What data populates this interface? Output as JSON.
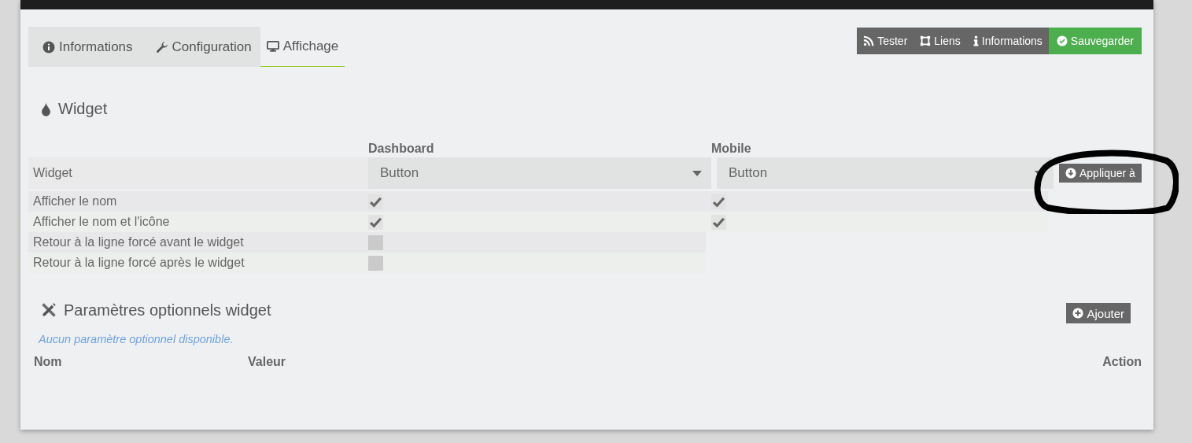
{
  "tabs": [
    {
      "label": "Informations",
      "selected": false
    },
    {
      "label": "Configuration",
      "selected": false
    },
    {
      "label": "Affichage",
      "selected": true
    }
  ],
  "actions": [
    {
      "label": "Tester",
      "kind": "default"
    },
    {
      "label": "Liens",
      "kind": "default"
    },
    {
      "label": "Informations",
      "kind": "default"
    },
    {
      "label": "Sauvegarder",
      "kind": "success"
    }
  ],
  "widget_section": {
    "title": "Widget",
    "columns": [
      "Dashboard",
      "Mobile"
    ],
    "widget_row": {
      "label": "Widget",
      "dashboard": "Button",
      "mobile": "Button",
      "apply_button": "Appliquer à"
    },
    "options": [
      {
        "label": "Afficher le nom",
        "dashboard_checked": true,
        "mobile_checked": true
      },
      {
        "label": "Afficher le nom et l'icône",
        "dashboard_checked": true,
        "mobile_checked": true
      },
      {
        "label": "Retour à la ligne forcé avant le widget",
        "dashboard_checked": false
      },
      {
        "label": "Retour à la ligne forcé après le widget",
        "dashboard_checked": false
      }
    ]
  },
  "optional_section": {
    "title": "Paramètres optionnels widget",
    "add_button": "Ajouter",
    "empty_message": "Aucun paramètre optionnel disponible.",
    "columns": [
      "Nom",
      "Valeur",
      "Action"
    ]
  }
}
